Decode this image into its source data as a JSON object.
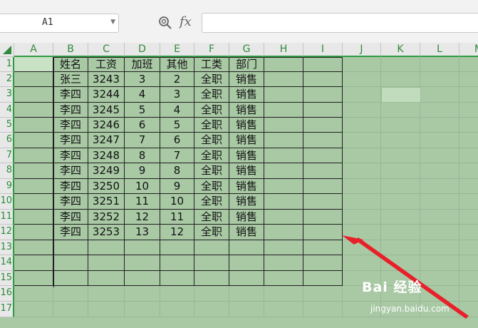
{
  "formula_bar": {
    "name_box": "A1",
    "fx_label": "fx",
    "formula": ""
  },
  "columns": [
    "A",
    "B",
    "C",
    "D",
    "E",
    "F",
    "G",
    "H",
    "I",
    "J",
    "K",
    "L",
    "M"
  ],
  "rows": [
    "1",
    "2",
    "3",
    "4",
    "5",
    "6",
    "7",
    "8",
    "9",
    "10",
    "11",
    "12",
    "13",
    "14",
    "15",
    "16",
    "17"
  ],
  "table": {
    "header": [
      "姓名",
      "工资",
      "加班",
      "其他",
      "工类",
      "部门"
    ],
    "rows": [
      [
        "张三",
        "3243",
        "3",
        "2",
        "全职",
        "销售"
      ],
      [
        "李四",
        "3244",
        "4",
        "3",
        "全职",
        "销售"
      ],
      [
        "李四",
        "3245",
        "5",
        "4",
        "全职",
        "销售"
      ],
      [
        "李四",
        "3246",
        "6",
        "5",
        "全职",
        "销售"
      ],
      [
        "李四",
        "3247",
        "7",
        "6",
        "全职",
        "销售"
      ],
      [
        "李四",
        "3248",
        "8",
        "7",
        "全职",
        "销售"
      ],
      [
        "李四",
        "3249",
        "9",
        "8",
        "全职",
        "销售"
      ],
      [
        "李四",
        "3250",
        "10",
        "9",
        "全职",
        "销售"
      ],
      [
        "李四",
        "3251",
        "11",
        "10",
        "全职",
        "销售"
      ],
      [
        "李四",
        "3252",
        "12",
        "11",
        "全职",
        "销售"
      ],
      [
        "李四",
        "3253",
        "13",
        "12",
        "全职",
        "销售"
      ]
    ]
  },
  "watermark": {
    "logo": "Bai 经验",
    "url": "jingyan.baidu.com"
  },
  "colors": {
    "sheet_bg": "#a9c9a5",
    "accent_green": "#2e8b3b",
    "arrow_red": "#e8202a"
  }
}
